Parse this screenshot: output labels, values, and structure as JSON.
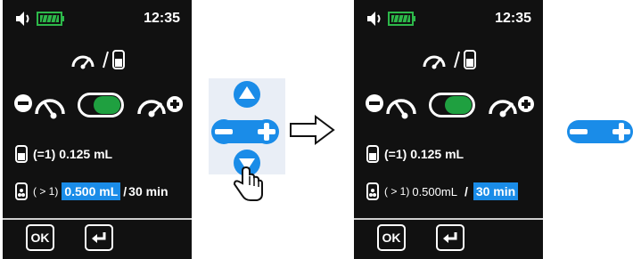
{
  "colors": {
    "screen_bg": "#111111",
    "accent_blue": "#1a8ce8",
    "toggle_green": "#1fa040",
    "battery_green": "#2db84a"
  },
  "status_bar": {
    "clock": "12:35"
  },
  "screens": [
    {
      "id": "before",
      "bolus": {
        "prefix": "(=1)",
        "value": "0.125 mL"
      },
      "rate": {
        "prefix": "( > 1)",
        "amount": "0.500 mL",
        "sep": "/",
        "interval": "30 min",
        "highlighted": "amount"
      },
      "buttons": {
        "ok": "OK"
      }
    },
    {
      "id": "after",
      "bolus": {
        "prefix": "(=1)",
        "value": "0.125 mL"
      },
      "rate": {
        "prefix": "( > 1)",
        "amount": "0.500mL",
        "sep": "/",
        "interval": "30 min",
        "highlighted": "interval"
      },
      "buttons": {
        "ok": "OK"
      }
    }
  ],
  "icons": [
    "speaker-icon",
    "battery-icon",
    "meter-icon",
    "vial-icon",
    "minus-icon",
    "plus-icon",
    "toggle-switch",
    "enter-icon",
    "up-icon",
    "down-icon",
    "hand-pointer-icon",
    "arrow-right-icon"
  ]
}
